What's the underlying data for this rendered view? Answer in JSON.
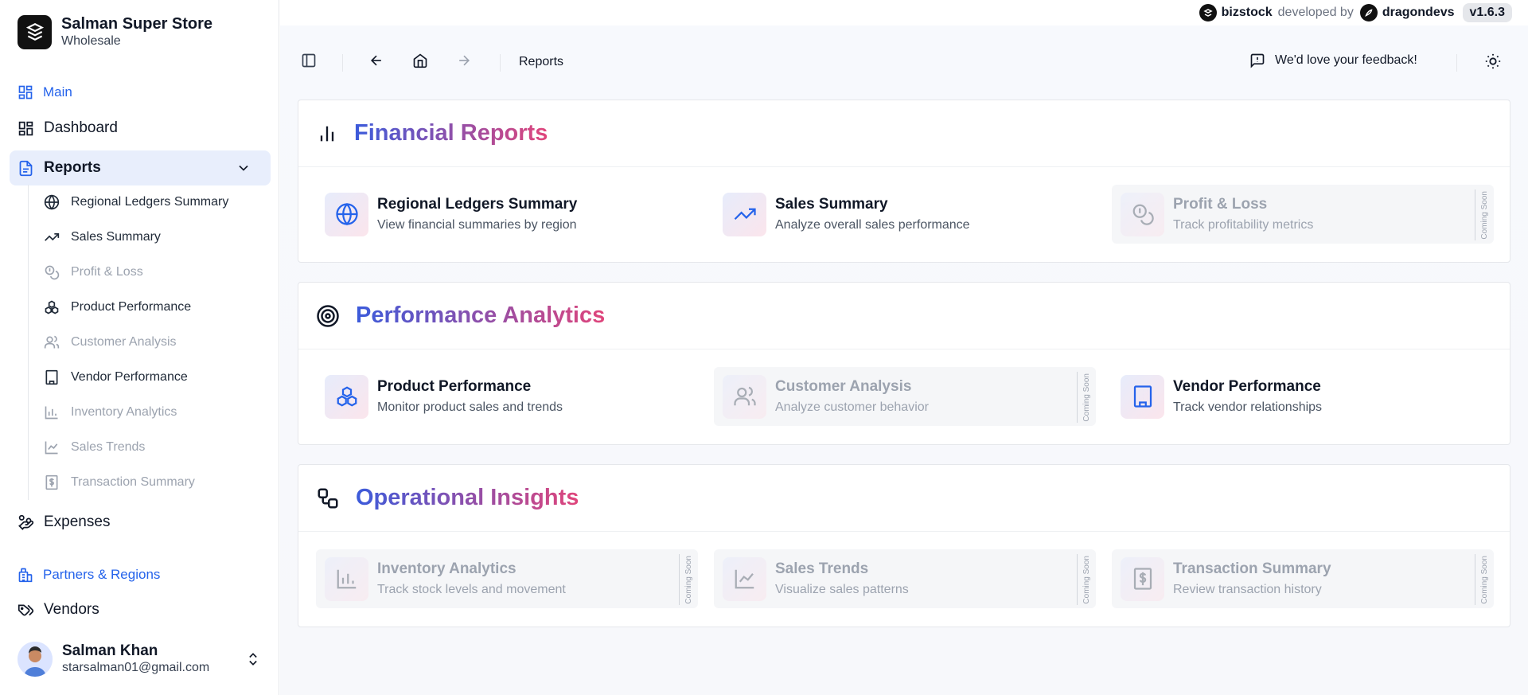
{
  "brand": {
    "name": "Salman Super Store",
    "subtitle": "Wholesale"
  },
  "sidebar": {
    "main_section": "Main",
    "dashboard": "Dashboard",
    "reports": "Reports",
    "reports_items": [
      {
        "label": "Regional Ledgers Summary",
        "icon": "globe-icon",
        "enabled": true
      },
      {
        "label": "Sales Summary",
        "icon": "trending-up-icon",
        "enabled": true
      },
      {
        "label": "Profit & Loss",
        "icon": "coins-icon",
        "enabled": false
      },
      {
        "label": "Product Performance",
        "icon": "boxes-icon",
        "enabled": true
      },
      {
        "label": "Customer Analysis",
        "icon": "users-icon",
        "enabled": false
      },
      {
        "label": "Vendor Performance",
        "icon": "building-icon",
        "enabled": true
      },
      {
        "label": "Inventory Analytics",
        "icon": "bar-chart-icon",
        "enabled": false
      },
      {
        "label": "Sales Trends",
        "icon": "line-chart-icon",
        "enabled": false
      },
      {
        "label": "Transaction Summary",
        "icon": "receipt-dollar-icon",
        "enabled": false
      }
    ],
    "expenses": "Expenses",
    "partners_section": "Partners & Regions",
    "vendors": "Vendors"
  },
  "user": {
    "name": "Salman Khan",
    "email": "starsalman01@gmail.com"
  },
  "topbar": {
    "product": "bizstock",
    "developed_by": "developed by",
    "developer": "dragondevs",
    "version": "v1.6.3"
  },
  "toolbar": {
    "breadcrumb": "Reports",
    "feedback": "We'd love your feedback!"
  },
  "sections": [
    {
      "title": "Financial Reports",
      "icon": "bar-chart-icon",
      "tiles": [
        {
          "title": "Regional Ledgers Summary",
          "desc": "View financial summaries by region",
          "icon": "globe-icon",
          "coming_soon": false
        },
        {
          "title": "Sales Summary",
          "desc": "Analyze overall sales performance",
          "icon": "trending-up-icon",
          "coming_soon": false
        },
        {
          "title": "Profit & Loss",
          "desc": "Track profitability metrics",
          "icon": "coins-icon",
          "coming_soon": true
        }
      ]
    },
    {
      "title": "Performance Analytics",
      "icon": "target-icon",
      "tiles": [
        {
          "title": "Product Performance",
          "desc": "Monitor product sales and trends",
          "icon": "boxes-icon",
          "coming_soon": false
        },
        {
          "title": "Customer Analysis",
          "desc": "Analyze customer behavior",
          "icon": "users-icon",
          "coming_soon": true
        },
        {
          "title": "Vendor Performance",
          "desc": "Track vendor relationships",
          "icon": "building-icon",
          "coming_soon": false
        }
      ]
    },
    {
      "title": "Operational Insights",
      "icon": "workflow-icon",
      "tiles": [
        {
          "title": "Inventory Analytics",
          "desc": "Track stock levels and movement",
          "icon": "bar-chart-icon",
          "coming_soon": true
        },
        {
          "title": "Sales Trends",
          "desc": "Visualize sales patterns",
          "icon": "line-chart-icon",
          "coming_soon": true
        },
        {
          "title": "Transaction Summary",
          "desc": "Review transaction history",
          "icon": "receipt-dollar-icon",
          "coming_soon": true
        }
      ]
    }
  ],
  "coming_soon_label": "Coming Soon",
  "colors": {
    "accent": "#2563eb",
    "gradient_start": "#3b5bdb",
    "gradient_end": "#e0457b",
    "active_bg": "#e8eefc"
  }
}
